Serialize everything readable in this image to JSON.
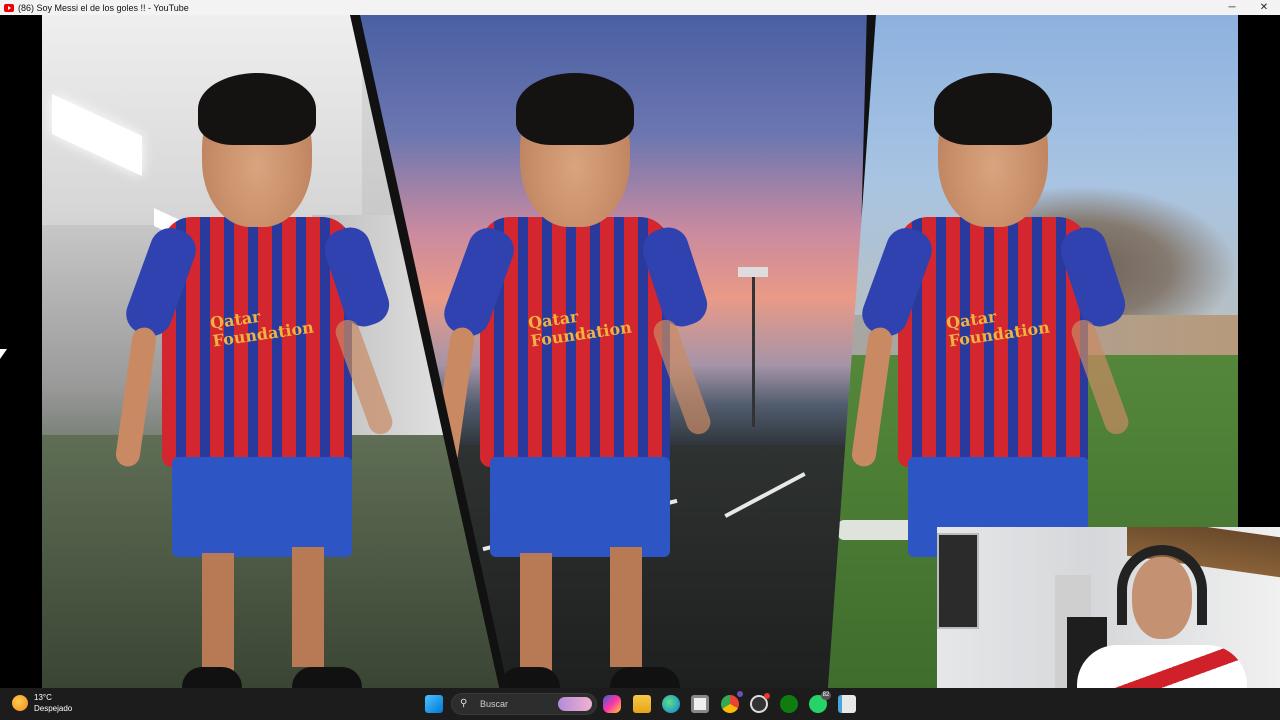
{
  "window": {
    "title": "(86) Soy Messi el de los goles !! - YouTube",
    "minimize_glyph": "─",
    "maximize_glyph": "❐",
    "close_glyph": "✕"
  },
  "video": {
    "logo_text_1": "Qatar",
    "logo_text_2": "Foundation"
  },
  "taskbar": {
    "weather_temp": "13°C",
    "weather_desc": "Despejado",
    "search_placeholder": "Buscar",
    "whatsapp_badge": "82",
    "icons": [
      "windows-start-icon",
      "search-icon",
      "copilot-icon",
      "file-explorer-icon",
      "edge-icon",
      "microsoft-store-icon",
      "chrome-icon",
      "obs-icon",
      "xbox-icon",
      "whatsapp-icon",
      "notepad-icon"
    ]
  },
  "colors": {
    "taskbar_bg": "#1c1c1c",
    "titlebar_bg": "#f3f3f3",
    "youtube_red": "#ee0000"
  }
}
